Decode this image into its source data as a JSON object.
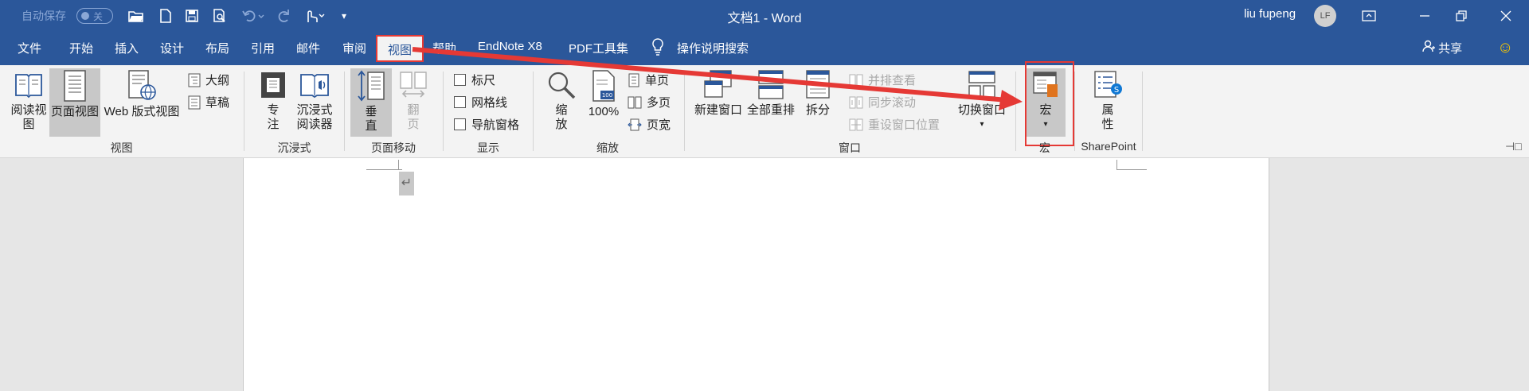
{
  "titlebar": {
    "autosave_label": "自动保存",
    "autosave_state": "关",
    "document_title": "文档1 - Word",
    "user_name": "liu fupeng",
    "avatar_initials": "LF",
    "icons": [
      "open-folder-icon",
      "new-document-icon",
      "save-icon",
      "print-preview-icon",
      "undo-icon",
      "redo-icon",
      "touch-mode-icon",
      "customize-quick-access-icon"
    ],
    "window_controls": [
      "ribbon-display-icon",
      "minimize-icon",
      "restore-icon",
      "close-icon"
    ]
  },
  "tabs": {
    "items": [
      "文件",
      "开始",
      "插入",
      "设计",
      "布局",
      "引用",
      "邮件",
      "审阅",
      "视图",
      "帮助",
      "EndNote X8",
      "PDF工具集"
    ],
    "active": "视图",
    "tell_me": "操作说明搜索",
    "share": "共享"
  },
  "ribbon": {
    "views": {
      "read_mode": "阅读视图",
      "print_layout": "页面视图",
      "web_layout": "Web 版式视图",
      "outline": "大纲",
      "draft": "草稿",
      "group": "视图"
    },
    "immersive": {
      "focus": "专注",
      "reader": "沉浸式阅读器",
      "group": "沉浸式"
    },
    "page_movement": {
      "vertical": "垂直",
      "flip": "翻页",
      "group": "页面移动"
    },
    "show": {
      "ruler": "标尺",
      "gridlines": "网格线",
      "nav_pane": "导航窗格",
      "group": "显示"
    },
    "zoom": {
      "zoom": "缩放",
      "hundred": "100%",
      "one_page": "单页",
      "multi_page": "多页",
      "page_width": "页宽",
      "group": "缩放"
    },
    "window": {
      "new_window": "新建窗口",
      "arrange_all": "全部重排",
      "split": "拆分",
      "side_by_side": "并排查看",
      "sync_scroll": "同步滚动",
      "reset_position": "重设窗口位置",
      "switch_windows": "切换窗口",
      "group": "窗口"
    },
    "macros": {
      "macros": "宏",
      "group": "宏"
    },
    "sharepoint": {
      "properties": "属性",
      "group": "SharePoint"
    }
  },
  "document": {
    "paragraph_mark": "↵"
  },
  "colors": {
    "accent": "#2b579a",
    "highlight": "#e53935"
  }
}
